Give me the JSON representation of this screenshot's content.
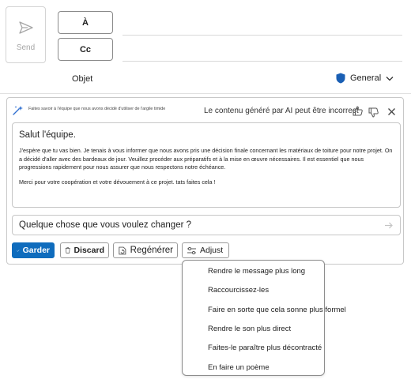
{
  "compose": {
    "send_label": "Send",
    "to_label": "À",
    "cc_label": "Cc",
    "subject_label": "Objet",
    "sensitivity_label": "General"
  },
  "copilot": {
    "prompt_text": "Faites savoir à l'équipe que nous avons décidé d'utiliser de l'argile timide",
    "disclaimer": "Le contenu généré par AI peut être incorrect",
    "draft": {
      "greeting": "Salut l'équipe.",
      "paragraph1": "J'espère que tu vas bien. Je tenais à vous informer que nous avons pris une décision finale concernant les matériaux de toiture pour notre projet. On a décidé d'aller avec des bardeaux de jour. Veuillez procéder aux préparatifs et à la mise en œuvre nécessaires. Il est essentiel que nous progressions rapidement pour nous assurer que nous respectons notre échéance.",
      "paragraph2": "Merci pour votre coopération et votre dévouement à ce projet. tats faites cela !"
    },
    "refine_placeholder": "Quelque chose que vous voulez changer ?",
    "keep_label": "Garder",
    "discard_label": "Discard",
    "regenerate_label": "Regénérer",
    "adjust_label": "Adjust"
  },
  "adjust_menu": {
    "items": [
      "Rendre le message plus long",
      "Raccourcissez-les",
      "Faire en sorte que cela sonne plus formel",
      "Rendre le son plus direct",
      "Faites-le paraître plus décontracté",
      "En faire un poème"
    ]
  },
  "colors": {
    "accent": "#0f6cbd",
    "shield": "#1a5fb4"
  }
}
